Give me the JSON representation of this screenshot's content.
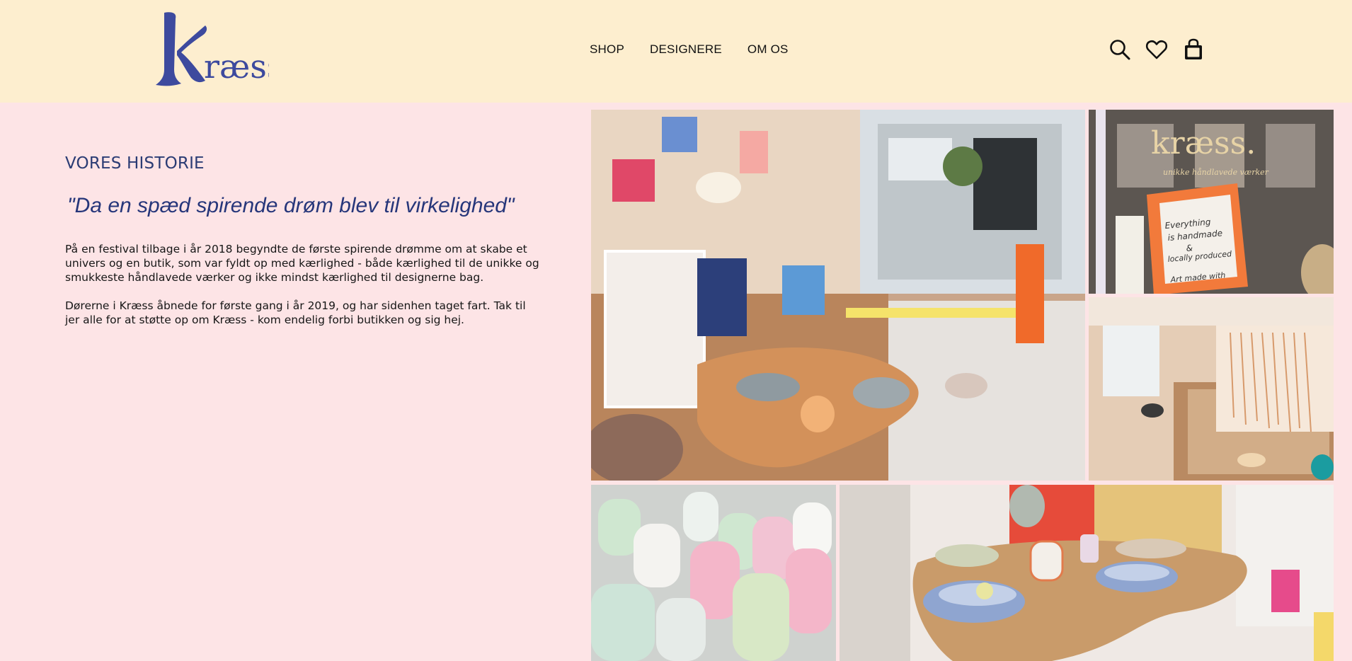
{
  "header": {
    "logo_text": "Kræss",
    "nav": [
      {
        "label": "SHOP"
      },
      {
        "label": "DESIGNERE"
      },
      {
        "label": "OM OS"
      }
    ],
    "icons": [
      "search-icon",
      "heart-icon",
      "shopping-bag-icon"
    ]
  },
  "story": {
    "kicker": "VORES HISTORIE",
    "quote": "\"Da en spæd spirende drøm blev til virkelighed\"",
    "paragraphs": [
      "På en festival tilbage i år 2018 begyndte de første spirende drømme om at skabe et univers og en butik, som var fyldt op med kærlighed - både kærlighed til de unikke og smukkeste håndlavede værker og ikke mindst kærlighed til designerne bag.",
      "Dørerne i Kræss åbnede for første gang i år 2019, og har sidenhen taget fart. Tak til jer alle for at støtte op om Kræss - kom endelig forbi butikken og sig hej."
    ]
  },
  "gallery": {
    "window_sign": "kræss.",
    "window_sign_sub": "unikke håndlavede værker",
    "board_text": [
      "Everything",
      "is handmade",
      "&",
      "locally produced",
      "Art made with"
    ]
  },
  "colors": {
    "header_bg": "#fdeecf",
    "page_bg": "#fde4e6",
    "brand_blue": "#3d4a9e",
    "heading_blue": "#26367a"
  }
}
